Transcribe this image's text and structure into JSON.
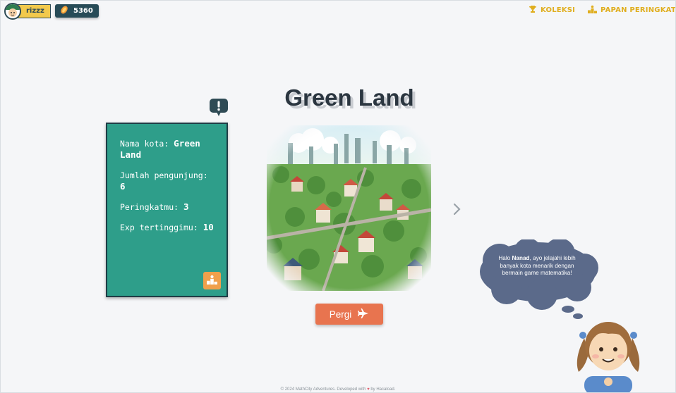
{
  "user": {
    "name": "rizzz",
    "coins": "5360"
  },
  "nav": {
    "collection": "KOLEKSI",
    "leaderboard": "PAPAN PERINGKAT"
  },
  "city": {
    "title": "Green Land",
    "info": [
      {
        "label": "Nama kota: ",
        "value": "Green Land"
      },
      {
        "label": "Jumlah pengunjung: ",
        "value": "6"
      },
      {
        "label": "Peringkatmu: ",
        "value": "3"
      },
      {
        "label": "Exp tertinggimu: ",
        "value": "10"
      }
    ]
  },
  "go_button": "Pergi",
  "speech": {
    "before": "Halo ",
    "name": "Nanad",
    "after": ", ayo jelajahi lebih banyak kota menarik dengan bermain game matematika!"
  },
  "footer": {
    "before": "© 2024 MathCity Adventures. Developed with ",
    "after": " by Hacaload."
  },
  "colors": {
    "card": "#2e9e8a",
    "accent": "#e8744f",
    "gold": "#e0ae1f",
    "dark": "#274b57"
  },
  "icons": [
    "trophy-icon",
    "podium-icon",
    "exclamation-icon",
    "plane-icon",
    "chevron-right-icon",
    "coin-icon",
    "heart-icon"
  ]
}
